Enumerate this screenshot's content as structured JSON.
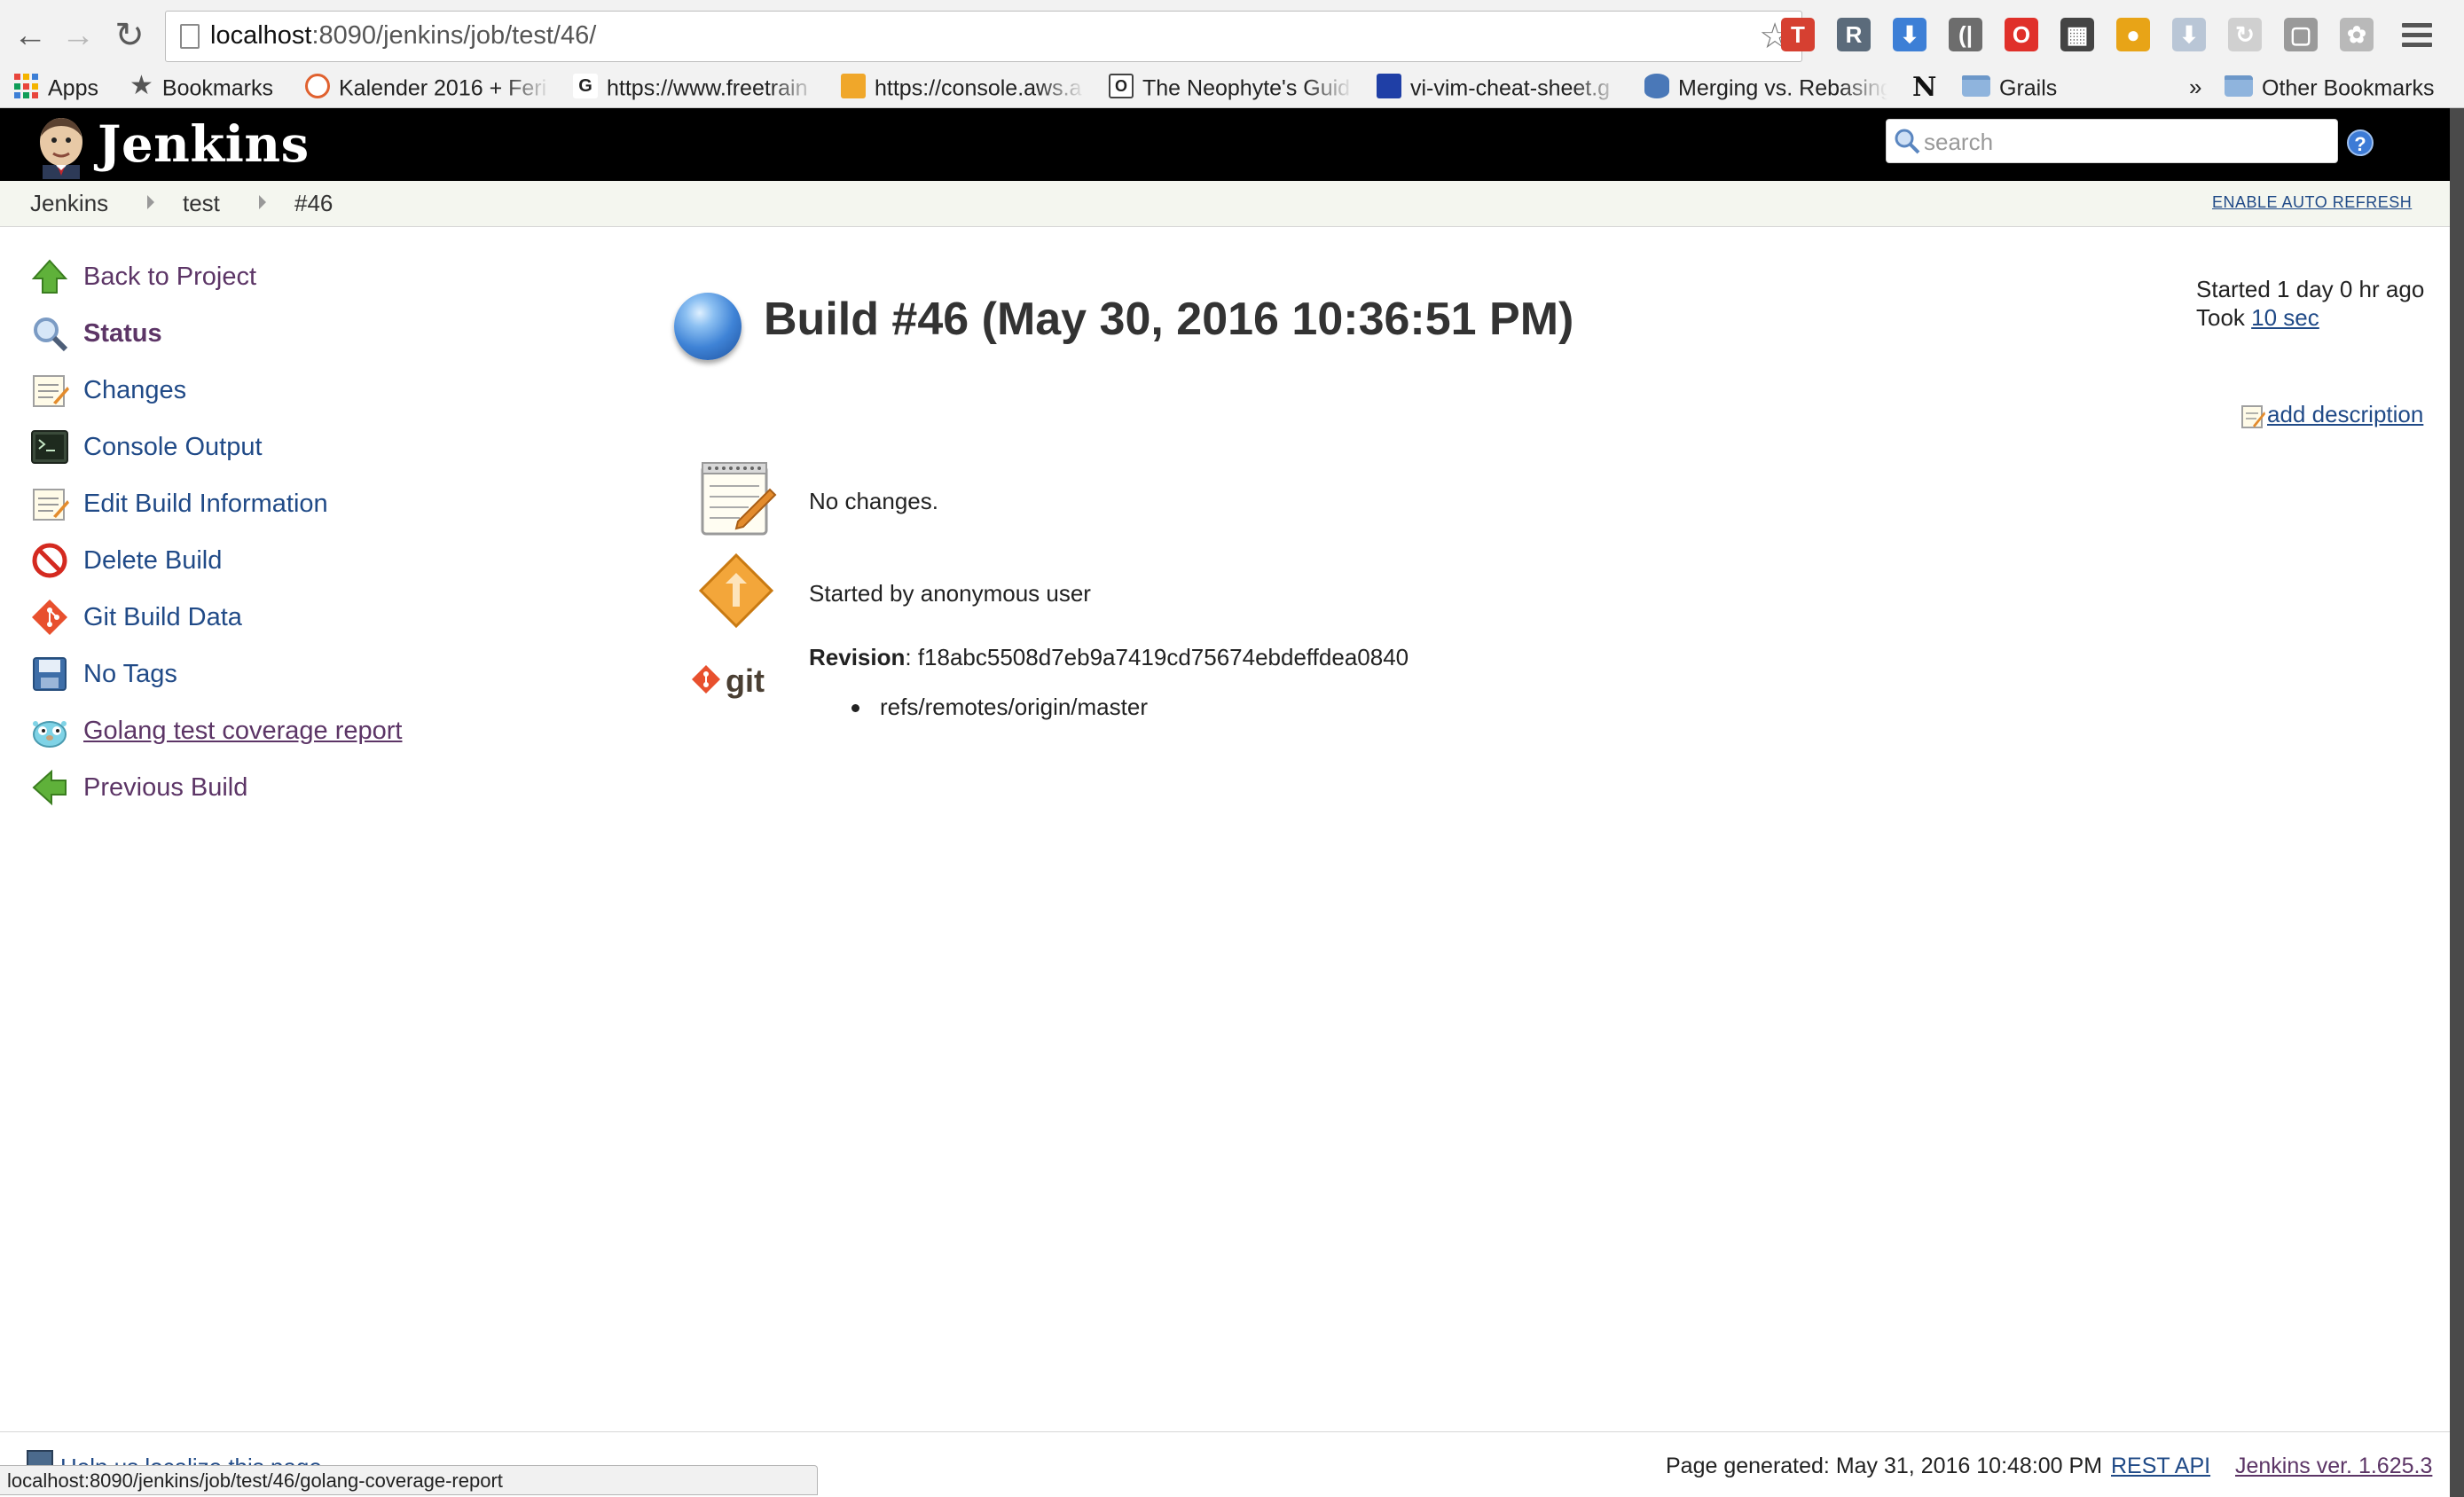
{
  "browser": {
    "url_host": "localhost",
    "url_rest": ":8090/jenkins/job/test/46/",
    "extensions": [
      {
        "name": "todoist-extension-icon",
        "letter": "T",
        "color": "#d64031"
      },
      {
        "name": "r-extension-icon",
        "letter": "R",
        "color": "#5b6b7b"
      },
      {
        "name": "download-arrow-extension-icon",
        "letter": "⬇",
        "color": "#3d7fd6"
      },
      {
        "name": "audio-extension-icon",
        "letter": "(|",
        "color": "#6d6d6d"
      },
      {
        "name": "opera-extension-icon",
        "letter": "O",
        "color": "#e0302a"
      },
      {
        "name": "film-extension-icon",
        "letter": "▦",
        "color": "#444444"
      },
      {
        "name": "chrome-extension-icon",
        "letter": "●",
        "color": "#e8a417"
      },
      {
        "name": "download-grey-extension-icon",
        "letter": "⬇",
        "color": "#b9c6d6"
      },
      {
        "name": "refresh-extension-icon",
        "letter": "↻",
        "color": "#d0d0d0"
      },
      {
        "name": "square-extension-icon",
        "letter": "▢",
        "color": "#9a9a9a"
      },
      {
        "name": "puzzle-extension-icon",
        "letter": "✿",
        "color": "#b9b9b9"
      }
    ],
    "bookmarks": [
      {
        "label": "Apps",
        "icon": "apps-grid-icon"
      },
      {
        "label": "Bookmarks",
        "icon": "star-icon"
      },
      {
        "label": "Kalender 2016 + Feri",
        "icon": "calendar-site-icon",
        "color": "#e0612f"
      },
      {
        "label": "https://www.freetrain",
        "icon": "gt-site-icon",
        "color": "#333333"
      },
      {
        "label": "https://console.aws.a",
        "icon": "aws-box-icon",
        "color": "#f0a72a"
      },
      {
        "label": "The Neophyte's Guid",
        "icon": "o-site-icon",
        "color": "#444444"
      },
      {
        "label": "vi-vim-cheat-sheet.g",
        "icon": "vim-site-icon",
        "color": "#1f3fa6"
      },
      {
        "label": "Merging vs. Rebasing",
        "icon": "database-icon",
        "color": "#4a78b8"
      },
      {
        "label": "",
        "icon": "notion-n-icon"
      },
      {
        "label": "Grails",
        "icon": "folder-icon"
      }
    ],
    "more_bookmarks": "»",
    "other_bookmarks": "Other Bookmarks",
    "status_url": "localhost:8090/jenkins/job/test/46/golang-coverage-report"
  },
  "header": {
    "logo_text": "Jenkins",
    "search_placeholder": "search",
    "help": "?"
  },
  "breadcrumb": {
    "items": [
      "Jenkins",
      "test",
      "#46"
    ],
    "auto_refresh": "ENABLE AUTO REFRESH"
  },
  "side_panel": {
    "tasks": [
      {
        "label": "Back to Project",
        "icon": "up-arrow-icon"
      },
      {
        "label": "Status",
        "icon": "magnifier-icon"
      },
      {
        "label": "Changes",
        "icon": "notepad-icon"
      },
      {
        "label": "Console Output",
        "icon": "terminal-icon"
      },
      {
        "label": "Edit Build Information",
        "icon": "notepad-edit-icon"
      },
      {
        "label": "Delete Build",
        "icon": "no-entry-icon"
      },
      {
        "label": "Git Build Data",
        "icon": "git-diamond-icon"
      },
      {
        "label": "No Tags",
        "icon": "floppy-disk-icon"
      },
      {
        "label": "Golang test coverage report",
        "icon": "gopher-icon"
      },
      {
        "label": "Previous Build",
        "icon": "left-arrow-icon"
      }
    ]
  },
  "build": {
    "title": "Build #46 (May 30, 2016 10:36:51 PM)",
    "started": "Started 1 day 0 hr ago",
    "took_prefix": "Took",
    "took_value": "10 sec",
    "add_description": "add description",
    "no_changes": "No changes.",
    "started_by": "Started by anonymous user",
    "revision_label": "Revision",
    "revision_hash": ": f18abc5508d7eb9a7419cd75674ebdeffdea0840",
    "branches": [
      "refs/remotes/origin/master"
    ],
    "git_logo_text": "git",
    "status_color": "#3f83d6"
  },
  "footer": {
    "localize": "Help us localize this page",
    "page_generated": "Page generated: May 31, 2016 10:48:00 PM",
    "rest_api": "REST API",
    "version": "Jenkins ver. 1.625.3"
  }
}
